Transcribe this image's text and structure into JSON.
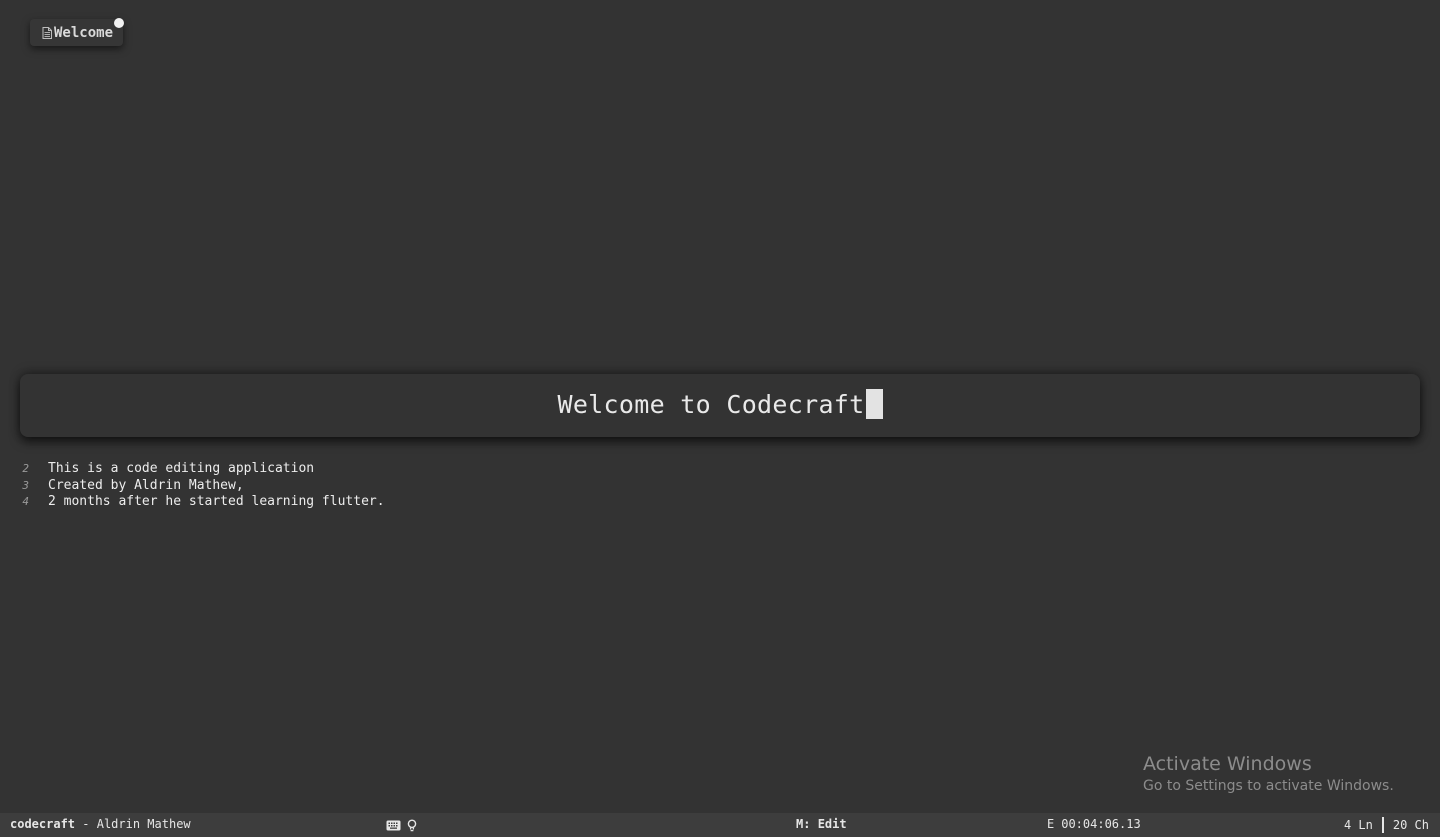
{
  "tab": {
    "icon": "file-icon",
    "label": "Welcome",
    "unsaved": true
  },
  "document": {
    "title": "Welcome to Codecraft",
    "lines": [
      {
        "number": "2",
        "text": "This is a code editing application"
      },
      {
        "number": "3",
        "text": "Created by Aldrin Mathew,"
      },
      {
        "number": "4",
        "text": "2 months after he started learning flutter."
      }
    ]
  },
  "watermark": {
    "title": "Activate Windows",
    "subtitle": "Go to Settings to activate Windows."
  },
  "status_bar": {
    "app_name": "codecraft",
    "separator": " - ",
    "author": "Aldrin Mathew",
    "icons": [
      "keyboard-icon",
      "lightbulb-icon"
    ],
    "mode_key": "M:",
    "mode_value": "Edit",
    "timer_label": "E",
    "timer_value": "00:04:06.13",
    "lines": "4 Ln",
    "chars": "20 Ch"
  },
  "colors": {
    "background": "#333333",
    "status_bar": "#3d3d3d",
    "text": "#e8e8e8",
    "line_number": "#9a9a9a",
    "watermark": "#8c8c8c"
  }
}
